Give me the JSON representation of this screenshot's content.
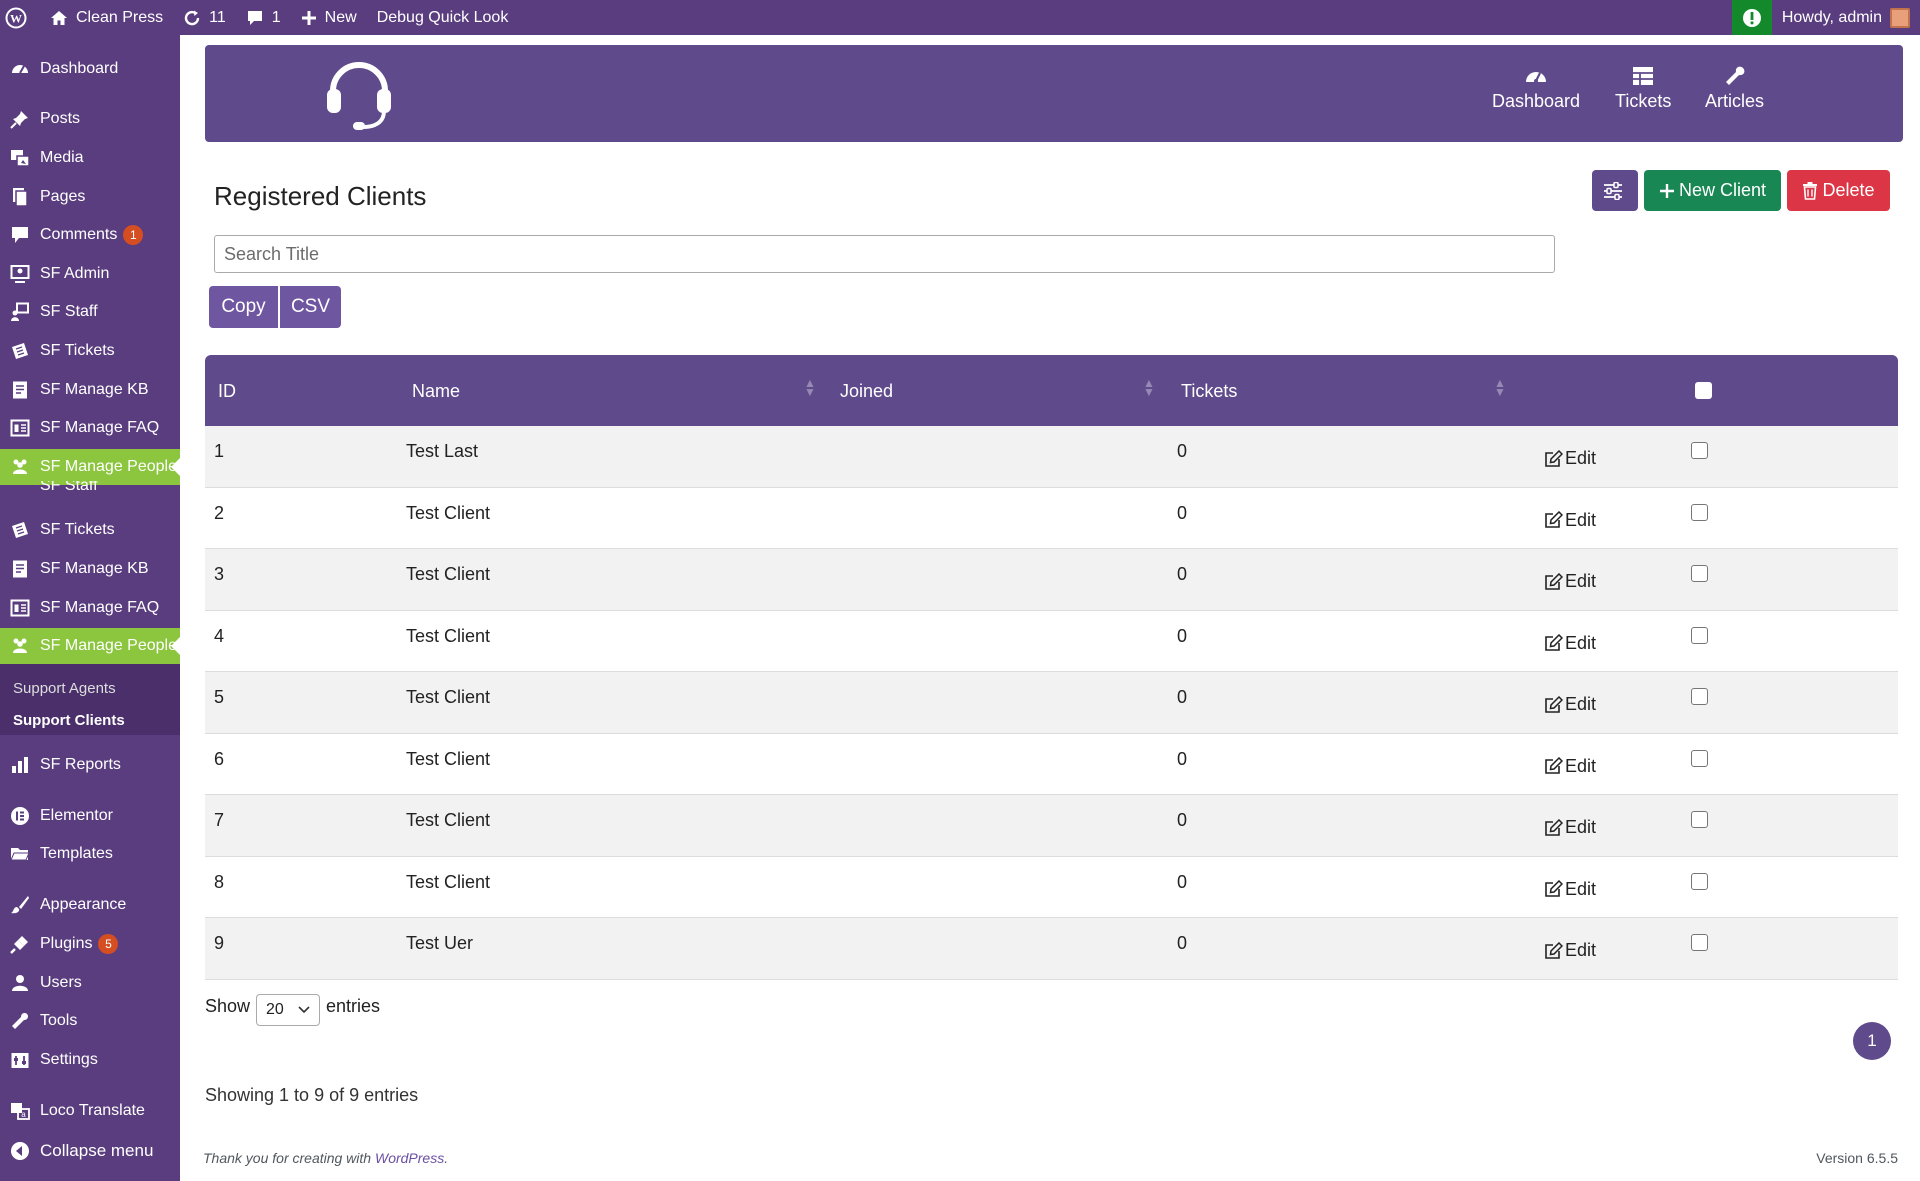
{
  "adminbar": {
    "site_name": "Clean Press",
    "updates_count": "11",
    "comments_count": "1",
    "new_label": "New",
    "debug_label": "Debug Quick Look",
    "howdy": "Howdy, admin"
  },
  "sidebar": {
    "items": [
      {
        "label": "Dashboard",
        "icon": "dashboard-icon"
      },
      {
        "label": "Posts",
        "icon": "pin-icon"
      },
      {
        "label": "Media",
        "icon": "media-icon"
      },
      {
        "label": "Pages",
        "icon": "pages-icon"
      },
      {
        "label": "Comments",
        "icon": "comment-icon",
        "badge": "1"
      },
      {
        "label": "SF Admin",
        "icon": "admin-icon"
      },
      {
        "label": "SF Staff",
        "icon": "staff-icon"
      },
      {
        "label": "SF Tickets",
        "icon": "tickets-icon"
      },
      {
        "label": "SF Manage KB",
        "icon": "kb-icon"
      },
      {
        "label": "SF Manage FAQ",
        "icon": "faq-icon"
      },
      {
        "label": "SF Manage People",
        "icon": "people-icon"
      },
      {
        "label": "SF Tickets",
        "icon": "tickets-icon"
      },
      {
        "label": "SF Manage KB",
        "icon": "kb-icon"
      },
      {
        "label": "SF Manage FAQ",
        "icon": "faq-icon"
      },
      {
        "label": "SF Manage People",
        "icon": "people-icon"
      },
      {
        "label": "SF Reports",
        "icon": "reports-icon"
      },
      {
        "label": "Elementor",
        "icon": "elementor-icon"
      },
      {
        "label": "Templates",
        "icon": "folder-icon"
      },
      {
        "label": "Appearance",
        "icon": "brush-icon"
      },
      {
        "label": "Plugins",
        "icon": "plugin-icon",
        "badge": "5"
      },
      {
        "label": "Users",
        "icon": "user-icon"
      },
      {
        "label": "Tools",
        "icon": "wrench-icon"
      },
      {
        "label": "Settings",
        "icon": "settings-icon"
      },
      {
        "label": "Loco Translate",
        "icon": "translate-icon"
      },
      {
        "label": "Collapse menu",
        "icon": "collapse-icon"
      }
    ],
    "ghost_label": "SF Staff",
    "submenu": [
      "Support Agents",
      "Support Clients"
    ]
  },
  "topnav": {
    "dashboard": "Dashboard",
    "tickets": "Tickets",
    "articles": "Articles"
  },
  "page": {
    "title": "Registered Clients",
    "new_client": "New Client",
    "delete": "Delete",
    "search_placeholder": "Search Title",
    "copy": "Copy",
    "csv": "CSV"
  },
  "table": {
    "headers": [
      "ID",
      "Name",
      "Joined",
      "Tickets"
    ],
    "edit_label": "Edit",
    "rows": [
      {
        "id": "1",
        "name": "Test Last",
        "joined": "",
        "tickets": "0"
      },
      {
        "id": "2",
        "name": "Test Client",
        "joined": "",
        "tickets": "0"
      },
      {
        "id": "3",
        "name": "Test Client",
        "joined": "",
        "tickets": "0"
      },
      {
        "id": "4",
        "name": "Test Client",
        "joined": "",
        "tickets": "0"
      },
      {
        "id": "5",
        "name": "Test Client",
        "joined": "",
        "tickets": "0"
      },
      {
        "id": "6",
        "name": "Test Client",
        "joined": "",
        "tickets": "0"
      },
      {
        "id": "7",
        "name": "Test Client",
        "joined": "",
        "tickets": "0"
      },
      {
        "id": "8",
        "name": "Test Client",
        "joined": "",
        "tickets": "0"
      },
      {
        "id": "9",
        "name": "Test Uer",
        "joined": "",
        "tickets": "0"
      }
    ]
  },
  "pager": {
    "show": "Show",
    "length": "20",
    "entries": "entries",
    "current_page": "1",
    "info": "Showing 1 to 9 of 9 entries"
  },
  "footer": {
    "thanks_prefix": "Thank you for creating with",
    "thanks_link": "WordPress",
    "thanks_suffix": ".",
    "version": "Version 6.5.5"
  },
  "colors": {
    "sidebar": "#5a3d7e",
    "header": "#5f4a8b",
    "active_menu": "#8cc63f",
    "new_button": "#198754",
    "delete_button": "#dc3545"
  }
}
